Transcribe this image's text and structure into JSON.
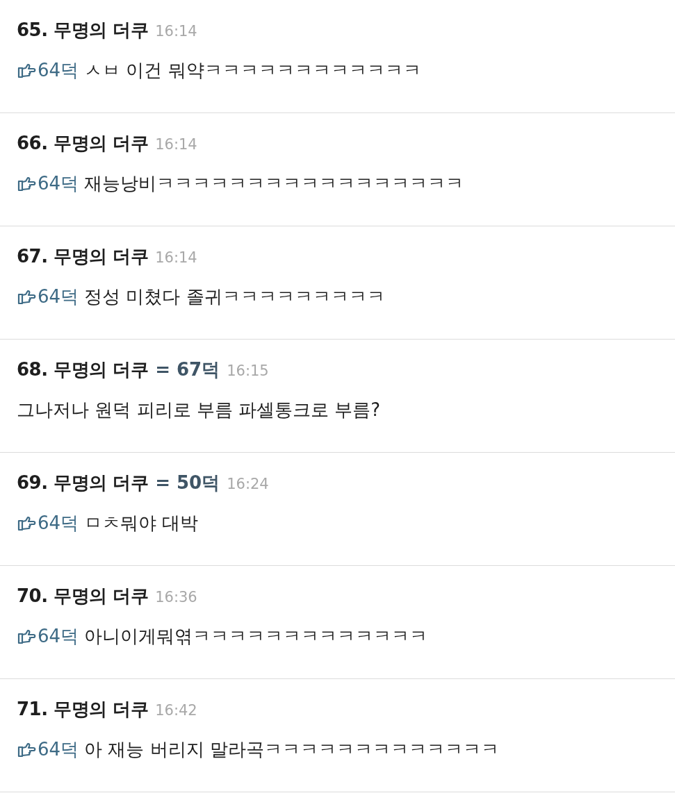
{
  "posts": [
    {
      "title": "65. 무명의 더쿠",
      "time": "16:14",
      "quote": "64덕",
      "text": "ㅅㅂ 이건 뭐약ㅋㅋㅋㅋㅋㅋㅋㅋㅋㅋㅋㅋ"
    },
    {
      "title": "66. 무명의 더쿠",
      "time": "16:14",
      "quote": "64덕",
      "text": "재능낭비ㅋㅋㅋㅋㅋㅋㅋㅋㅋㅋㅋㅋㅋㅋㅋㅋㅋ"
    },
    {
      "title": "67. 무명의 더쿠",
      "time": "16:14",
      "quote": "64덕",
      "text": "정성 미쳤다 졸귀ㅋㅋㅋㅋㅋㅋㅋㅋㅋ"
    },
    {
      "title": "68. 무명의 더쿠",
      "reply_to": "= 67덕",
      "time": "16:15",
      "text": "그나저나 원덕 피리로 부름 파셀통크로 부름?"
    },
    {
      "title": "69. 무명의 더쿠",
      "reply_to": "= 50덕",
      "time": "16:24",
      "quote": "64덕",
      "text": "ㅁㅊ뭐야 대박"
    },
    {
      "title": "70. 무명의 더쿠",
      "time": "16:36",
      "quote": "64덕",
      "text": "아니이게뭐엮ㅋㅋㅋㅋㅋㅋㅋㅋㅋㅋㅋㅋㅋ"
    },
    {
      "title": "71. 무명의 더쿠",
      "time": "16:42",
      "quote": "64덕",
      "text": "아 재능 버리지 말라곡ㅋㅋㅋㅋㅋㅋㅋㅋㅋㅋㅋㅋㅋ"
    }
  ]
}
